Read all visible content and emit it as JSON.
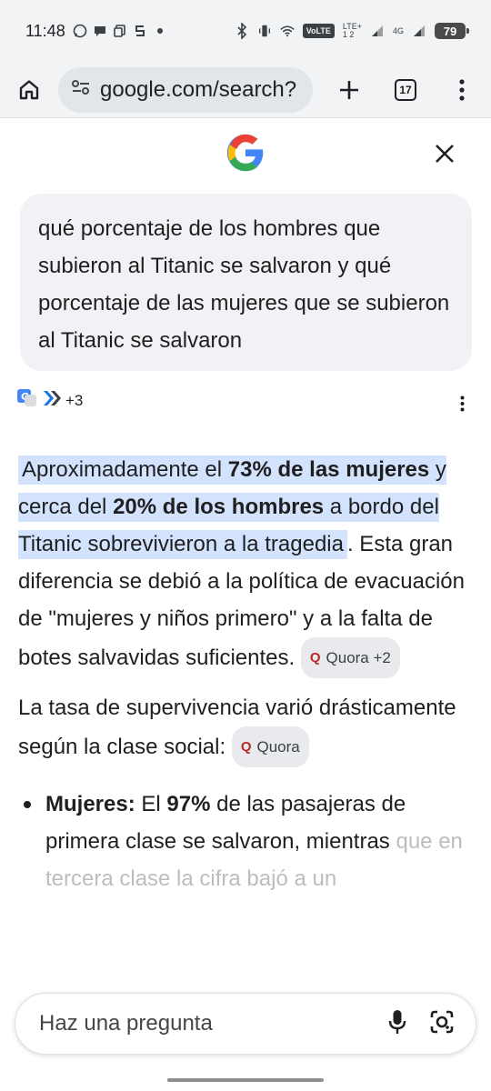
{
  "status_bar": {
    "time": "11:48",
    "volte": "VoLTE",
    "lte_label": "LTE+",
    "lte_sub": "1 2",
    "net_4g": "4G",
    "battery": "79"
  },
  "browser": {
    "url": "google.com/search?",
    "tab_count": "17"
  },
  "query": {
    "text": "qué porcentaje de los hombres que subieron al Titanic se salvaron y qué porcentaje de las mujeres que se subieron al Titanic se salvaron"
  },
  "sources": {
    "more_count": "+3"
  },
  "answer": {
    "p1_a": "Aproximadamente el ",
    "p1_b": "73% de las mujeres",
    "p1_c": " y cerca del ",
    "p1_d": "20% de los hombres",
    "p1_e": " a bordo del Titanic ",
    "p1_f": "sobrevivieron a la tragedia",
    "p1_g": ". Esta gran diferencia se debió a la política de evacuación de \"mujeres y niños primero\" y a la falta de botes salvavidas suficientes.",
    "chip1_label": "Quora +2",
    "p2": "La tasa de supervivencia varió drásticamente según la clase social:",
    "chip2_label": "Quora",
    "bullet1_label": "Mujeres:",
    "bullet1_a": " El ",
    "bullet1_b": "97%",
    "bullet1_c": " de las pasajeras de primera clase se salvaron, mientras",
    "bullet1_faded": " que en tercera clase la cifra bajó a un"
  },
  "ask_bar": {
    "placeholder": "Haz una pregunta"
  },
  "icons": {
    "home": "home-icon",
    "site_settings": "tune-icon",
    "new_tab": "plus-icon",
    "tabs": "tab-switcher-icon",
    "menu": "more-vert-icon",
    "close": "close-icon",
    "mic": "mic-icon",
    "lens": "lens-icon"
  }
}
